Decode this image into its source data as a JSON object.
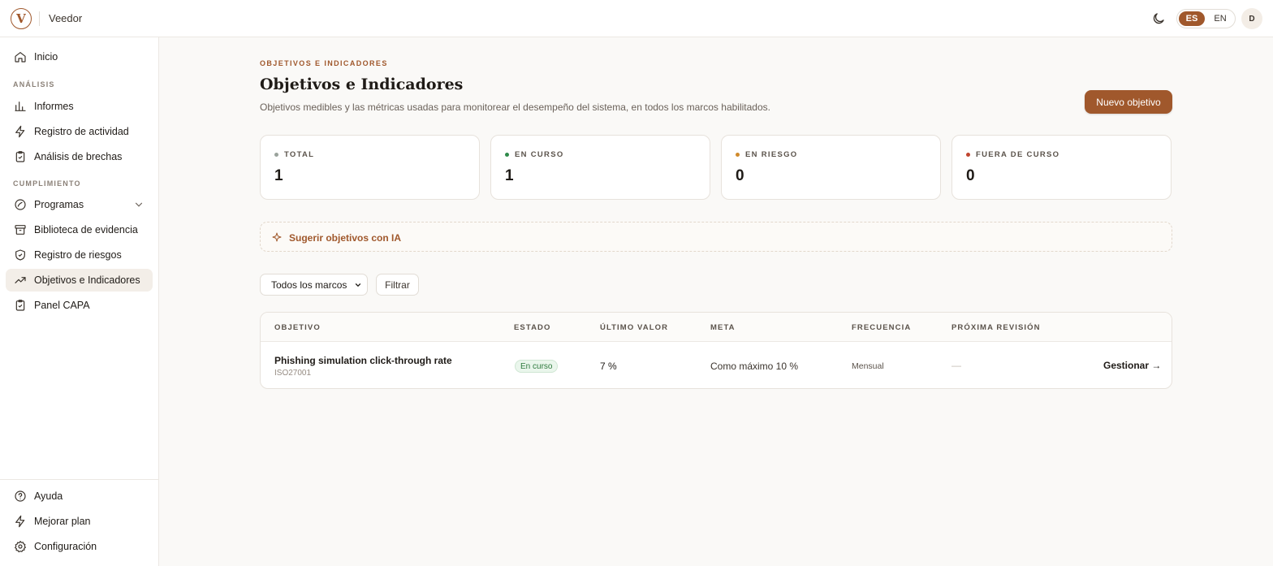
{
  "app": {
    "brand": "Veedor",
    "logo_letter": "V"
  },
  "topbar": {
    "lang_es": "ES",
    "lang_en": "EN",
    "avatar_initial": "D"
  },
  "sidebar": {
    "home": "Inicio",
    "section_analysis": "ANÁLISIS",
    "reports": "Informes",
    "activity_log": "Registro de actividad",
    "gap_analysis": "Análisis de brechas",
    "section_compliance": "CUMPLIMIENTO",
    "programs": "Programas",
    "evidence_library": "Biblioteca de evidencia",
    "risk_register": "Registro de riesgos",
    "objectives": "Objetivos e Indicadores",
    "capa_panel": "Panel CAPA",
    "help": "Ayuda",
    "upgrade": "Mejorar plan",
    "settings": "Configuración"
  },
  "header": {
    "eyebrow": "OBJETIVOS E INDICADORES",
    "title": "Objetivos e Indicadores",
    "subtitle": "Objetivos medibles y las métricas usadas para monitorear el desempeño del sistema, en todos los marcos habilitados.",
    "new_button": "Nuevo objetivo"
  },
  "stats": [
    {
      "label": "TOTAL",
      "value": "1",
      "color": "#9aa39c"
    },
    {
      "label": "EN CURSO",
      "value": "1",
      "color": "#2f8a4a"
    },
    {
      "label": "EN RIESGO",
      "value": "0",
      "color": "#d08a2c"
    },
    {
      "label": "FUERA DE CURSO",
      "value": "0",
      "color": "#c0452f"
    }
  ],
  "suggest": {
    "label": "Sugerir objetivos con IA"
  },
  "filters": {
    "framework_select": "Todos los marcos",
    "filter_button": "Filtrar"
  },
  "table": {
    "columns": [
      "OBJETIVO",
      "ESTADO",
      "ÚLTIMO VALOR",
      "META",
      "FRECUENCIA",
      "PRÓXIMA REVISIÓN"
    ],
    "rows": [
      {
        "name": "Phishing simulation click-through rate",
        "framework": "ISO27001",
        "status": "En curso",
        "last_value": "7 %",
        "target": "Como máximo 10 %",
        "frequency": "Mensual",
        "next_review": "—",
        "action": "Gestionar →"
      }
    ]
  },
  "colors": {
    "accent": "#a0582c",
    "background": "#faf9f7"
  }
}
